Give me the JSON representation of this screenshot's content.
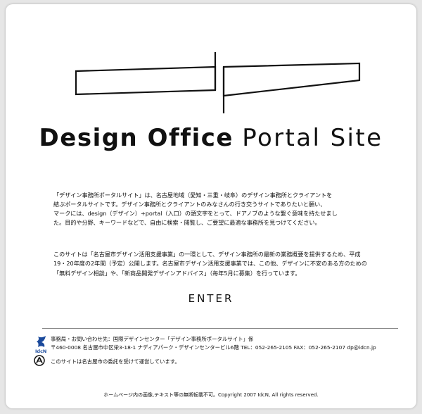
{
  "site": {
    "title_bold": "Design Office",
    "title_light": "Portal Site"
  },
  "intro": {
    "para1": [
      "「デザイン事務所ポータルサイト」は、名古屋地域（愛知・三重・岐阜）のデザイン事務所とクライアントを",
      "結ぶポータルサイトです。デザイン事務所とクライアントのみなさんの行き交うサイトでありたいと願い、",
      "マークには、design（デザイン）+portal（入口）の頭文字をとって、ドアノブのような繋ぐ意味を持たせまし",
      "た。目的や分野、キーワードなどで、自由に検索・閲覧し、ご要望に最適な事務所を見つけてください。"
    ],
    "para2": [
      "このサイトは「名古屋市デザイン活用支援事業」の一環として、デザイン事務所の最新の業務概要を提供するため、平成",
      "19・20年度の2年間（予定）公開します。名古屋市デザイン活用支援事業では、この他、デザインに不安のある方のための",
      "「無料デザイン相談」や、「新商品開発デザインアドバイス」（毎年5月に募集）を行っています。"
    ]
  },
  "enter_label": "ENTER",
  "footer": {
    "org_logo_text": "IdcN",
    "contact_line1": "事務局・お問い合わせ先：国際デザインセンター「デザイン事務所ポータルサイト」係",
    "contact_line2": "〒460-0008 名古屋市中区栄3-18-1 ナディアパーク・デザインセンタービル6階 TEL：052-265-2105 FAX：052-265-2107 dp@idcn.jp",
    "commission": "このサイトは名古屋市の委託を受けて運営しています。",
    "copyright": "ホームページ内の画像,テキスト等の無断転載不可。Copyright 2007 IdcN, All rights reserved."
  },
  "icons": {
    "logo": "dp-doorknob-logo",
    "org": "idcn-logo-icon",
    "city": "nagoya-city-emblem-icon"
  },
  "colors": {
    "background": "#e6e6e6",
    "page": "#ffffff",
    "text": "#111111",
    "idcn_blue": "#1b4a9c"
  }
}
